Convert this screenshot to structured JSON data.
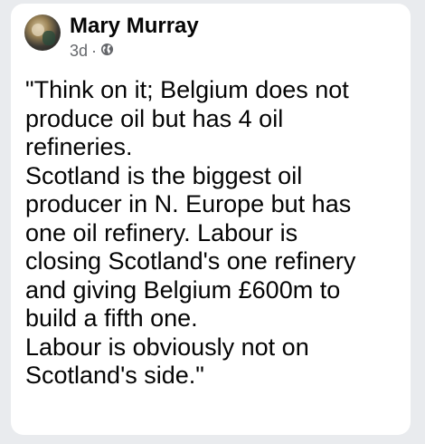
{
  "post": {
    "author": "Mary Murray",
    "time": "3d",
    "separator": "·",
    "privacy_icon": "globe-icon",
    "lines": [
      "\"Think on it; Belgium does not",
      "produce oil but has 4 oil",
      "refineries.",
      "Scotland is the biggest oil",
      "producer in N. Europe but has",
      "one oil refinery. Labour is",
      "closing Scotland's one refinery",
      "and giving Belgium £600m to",
      "build a fifth one.",
      "Labour is obviously not on",
      "Scotland's side.\""
    ]
  }
}
